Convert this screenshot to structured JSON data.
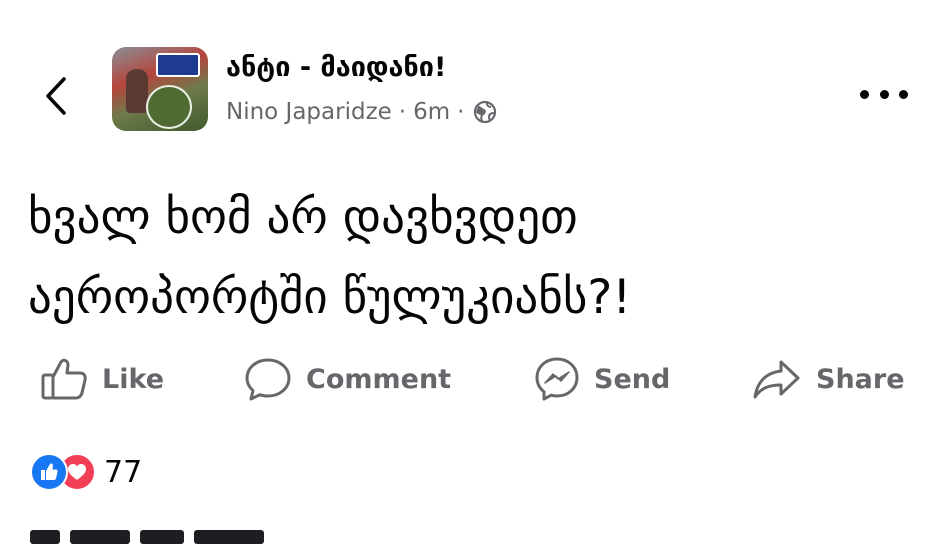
{
  "header": {
    "page_name": "ანტი - მაიდანი!",
    "author": "Nino Japaridze",
    "separator": "·",
    "time": "6m"
  },
  "post": {
    "line1": "ხვალ ხომ არ დავხვდეთ",
    "line2": "აეროპორტში წულუკიანს?!"
  },
  "actions": {
    "like": "Like",
    "comment": "Comment",
    "send": "Send",
    "share": "Share"
  },
  "reactions": {
    "count": "77"
  },
  "colors": {
    "text": "#050505",
    "secondary": "#65676b",
    "like_blue": "#1877f2",
    "love_red": "#f33e58"
  },
  "icons": [
    "back-arrow-icon",
    "globe-icon",
    "more-icon",
    "like-icon",
    "comment-icon",
    "messenger-icon",
    "share-icon",
    "like-reaction-icon",
    "love-reaction-icon"
  ]
}
